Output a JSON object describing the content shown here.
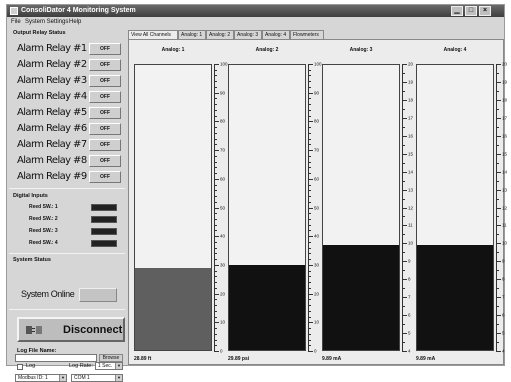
{
  "window": {
    "title": "ConsoliDator 4 Monitoring System",
    "controls": [
      "minimize-icon",
      "maximize-icon",
      "close-icon"
    ]
  },
  "menu": [
    "File",
    "System Settings",
    "Help"
  ],
  "relays": {
    "title": "Output Relay Status",
    "items": [
      {
        "label": "Alarm Relay #1",
        "state": "OFF"
      },
      {
        "label": "Alarm Relay #2",
        "state": "OFF"
      },
      {
        "label": "Alarm Relay #3",
        "state": "OFF"
      },
      {
        "label": "Alarm Relay #4",
        "state": "OFF"
      },
      {
        "label": "Alarm Relay #5",
        "state": "OFF"
      },
      {
        "label": "Alarm Relay #6",
        "state": "OFF"
      },
      {
        "label": "Alarm Relay #7",
        "state": "OFF"
      },
      {
        "label": "Alarm Relay #8",
        "state": "OFF"
      },
      {
        "label": "Alarm Relay #9",
        "state": "OFF"
      }
    ]
  },
  "digital_inputs": {
    "title": "Digital Inputs",
    "items": [
      {
        "label": "Reed SW.: 1"
      },
      {
        "label": "Reed SW.: 2"
      },
      {
        "label": "Reed SW.: 3"
      },
      {
        "label": "Reed SW.: 4"
      }
    ]
  },
  "system": {
    "title": "System Status",
    "status": "System Online"
  },
  "connection": {
    "button_label": "Disconnect"
  },
  "logging": {
    "file_label": "Log File Name:",
    "file_value": "",
    "browse_label": "Browse",
    "log_checkbox_label": "Log",
    "log_enabled": false,
    "log_rate_label": "Log Rate:",
    "log_rate_value": "1 Sec.",
    "modbus_value": "Modbus ID: 1",
    "com_value": "COM 1"
  },
  "tabs": [
    {
      "label": "View All Channels",
      "active": true
    },
    {
      "label": "Analog: 1",
      "active": false
    },
    {
      "label": "Analog: 2",
      "active": false
    },
    {
      "label": "Analog: 3",
      "active": false
    },
    {
      "label": "Analog: 4",
      "active": false
    },
    {
      "label": "Flowmeters",
      "active": false
    }
  ],
  "channels": [
    {
      "name": "Analog: 1",
      "min": 0,
      "max": 100,
      "major_step": 10,
      "minor_step": 2,
      "value": 28.89,
      "readout": "28.89 ft",
      "fill_color": "#5f5f5f"
    },
    {
      "name": "Analog: 2",
      "min": 0,
      "max": 100,
      "major_step": 10,
      "minor_step": 2,
      "value": 29.89,
      "readout": "29.89 psi",
      "fill_color": "#111111"
    },
    {
      "name": "Analog: 3",
      "min": 4,
      "max": 20,
      "major_step": 1,
      "minor_step": 0.5,
      "value": 9.89,
      "readout": "9.89 mA",
      "fill_color": "#111111"
    },
    {
      "name": "Analog: 4",
      "min": 4,
      "max": 20,
      "major_step": 1,
      "minor_step": 0.5,
      "value": 9.89,
      "readout": "9.89 mA",
      "fill_color": "#111111"
    }
  ]
}
